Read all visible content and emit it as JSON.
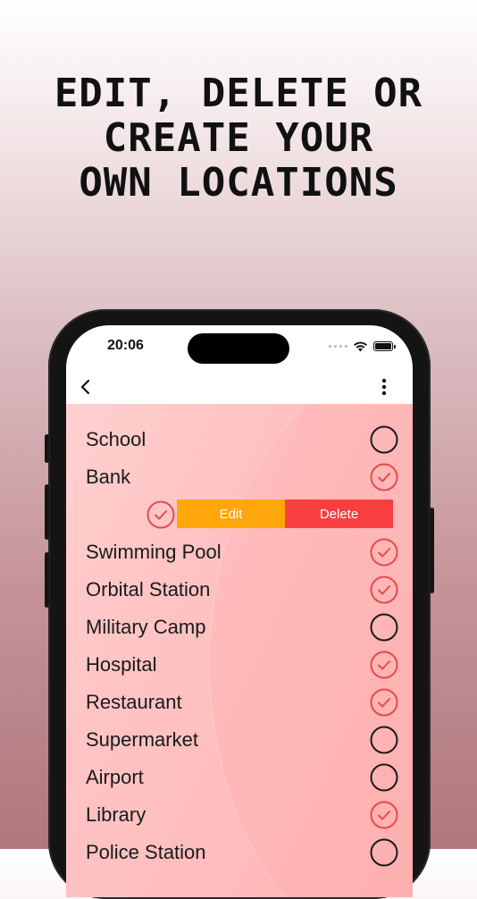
{
  "headline": {
    "line1": "EDIT, DELETE OR",
    "line2": "CREATE YOUR",
    "line3": "OWN LOCATIONS"
  },
  "status_bar": {
    "time": "20:06",
    "icons": [
      "signal-dots-icon",
      "wifi-icon",
      "battery-icon"
    ]
  },
  "nav": {
    "back_icon": "chevron-left-icon",
    "menu_icon": "more-vertical-icon"
  },
  "swipe_actions": {
    "edit_label": "Edit",
    "delete_label": "Delete"
  },
  "locations": [
    {
      "name": "School",
      "checked": false
    },
    {
      "name": "Bank",
      "checked": true
    },
    {
      "name": "Swimming Pool",
      "checked": true
    },
    {
      "name": "Orbital Station",
      "checked": true
    },
    {
      "name": "Military Camp",
      "checked": false
    },
    {
      "name": "Hospital",
      "checked": true
    },
    {
      "name": "Restaurant",
      "checked": true
    },
    {
      "name": "Supermarket",
      "checked": false
    },
    {
      "name": "Airport",
      "checked": false
    },
    {
      "name": "Library",
      "checked": true
    },
    {
      "name": "Police Station",
      "checked": false
    }
  ],
  "colors": {
    "check_red": "#e84a4a",
    "unchecked_black": "#1a1a1a",
    "edit_orange": "#ffa60a",
    "delete_red": "#f83e3e"
  }
}
